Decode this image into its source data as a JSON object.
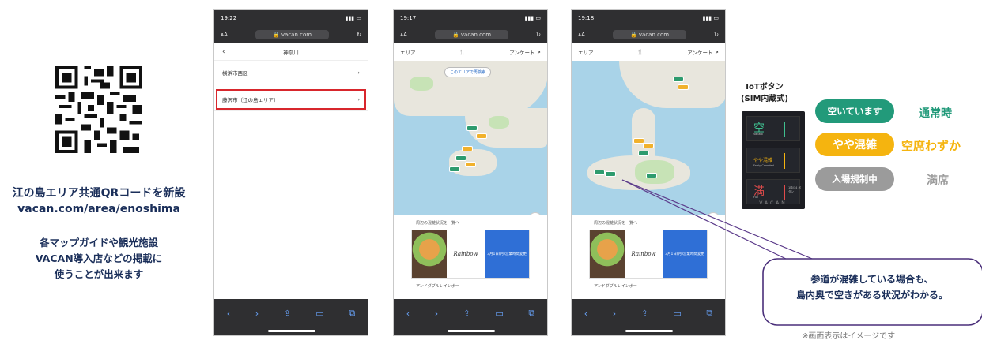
{
  "left": {
    "line1": "江の島エリア共通QRコードを新設",
    "line2": "vacan.com/area/enoshima",
    "line3": "各マップガイドや観光施設",
    "line4": "VACAN導入店などの掲載に",
    "line5": "使うことが出来ます"
  },
  "phones": {
    "url": "vacan.com",
    "aa": "ᴀA",
    "phone1": {
      "time": "19:22",
      "header": "神奈川",
      "rows": [
        "横浜市西区",
        "藤沢市（江の島エリア）"
      ]
    },
    "phone2": {
      "time": "19:17",
      "area_label": "エリア",
      "survey_label": "アンケート",
      "area_button": "このエリアで再検索",
      "list_label": "周辺の混雑状況を一覧へ",
      "shop_name": "アンドダブルレインボー",
      "card_logo": "Rainbow",
      "card_blue": "3月1日(月)営業時間変更"
    },
    "phone3": {
      "time": "19:18",
      "area_label": "エリア",
      "survey_label": "アンケート",
      "list_label": "周辺の混雑状況を一覧へ",
      "shop_name": "アンドダブルレインボー",
      "card_logo": "Rainbow",
      "card_blue": "3月1日(月)営業時間変更"
    }
  },
  "iot": {
    "title1": "IoTボタン",
    "title2": "(SIM内蔵式)",
    "key1_big": "空",
    "key1_small": "Vacant",
    "key2_big": "やや混雑",
    "key2_small": "Fairly Crowded",
    "key3_big": "満",
    "key3_small": "Full",
    "key3_side": "1時/14 ボタン",
    "brand": "VACAN",
    "pills": [
      "空いています",
      "やや混雑",
      "入場規制中"
    ],
    "statuses": [
      "通常時",
      "空席わずか",
      "満席"
    ],
    "colors": {
      "green": "#229a7a",
      "yellow": "#f5b40f",
      "gray": "#9b9b9b"
    }
  },
  "callout": {
    "line1": "参道が混雑している場合も、",
    "line2": "島内奥で空きがある状況がわかる。"
  },
  "note": "※画面表示はイメージです"
}
